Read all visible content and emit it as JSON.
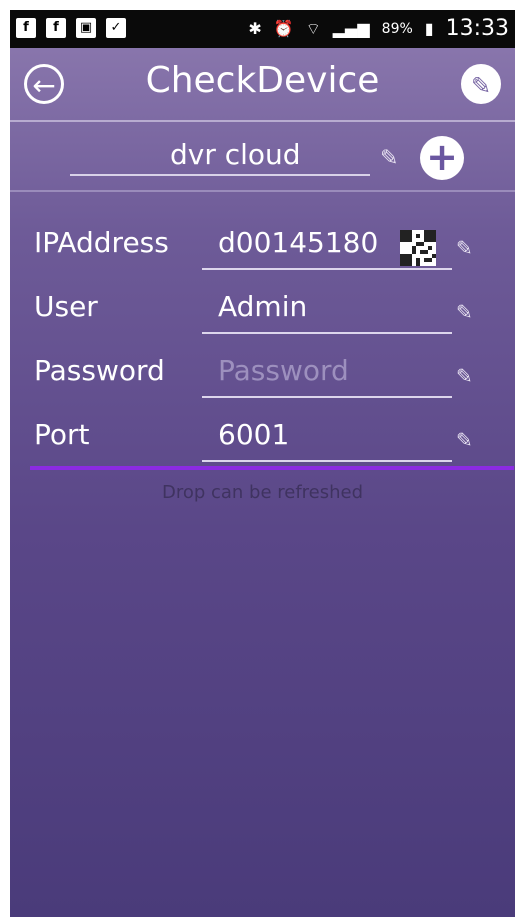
{
  "status_bar": {
    "battery": "89%",
    "time": "13:33"
  },
  "header": {
    "title": "CheckDevice"
  },
  "device": {
    "name": "dvr cloud"
  },
  "fields": {
    "ip_address": {
      "label": "IPAddress",
      "value": "d00145180"
    },
    "user": {
      "label": "User",
      "value": "Admin"
    },
    "password": {
      "label": "Password",
      "placeholder": "Password"
    },
    "port": {
      "label": "Port",
      "value": "6001"
    }
  },
  "hint": "Drop can be refreshed",
  "colors": {
    "accent_line": "#8b2be2",
    "background_top": "#8e7bb0",
    "background_bottom": "#4a3b7a"
  }
}
